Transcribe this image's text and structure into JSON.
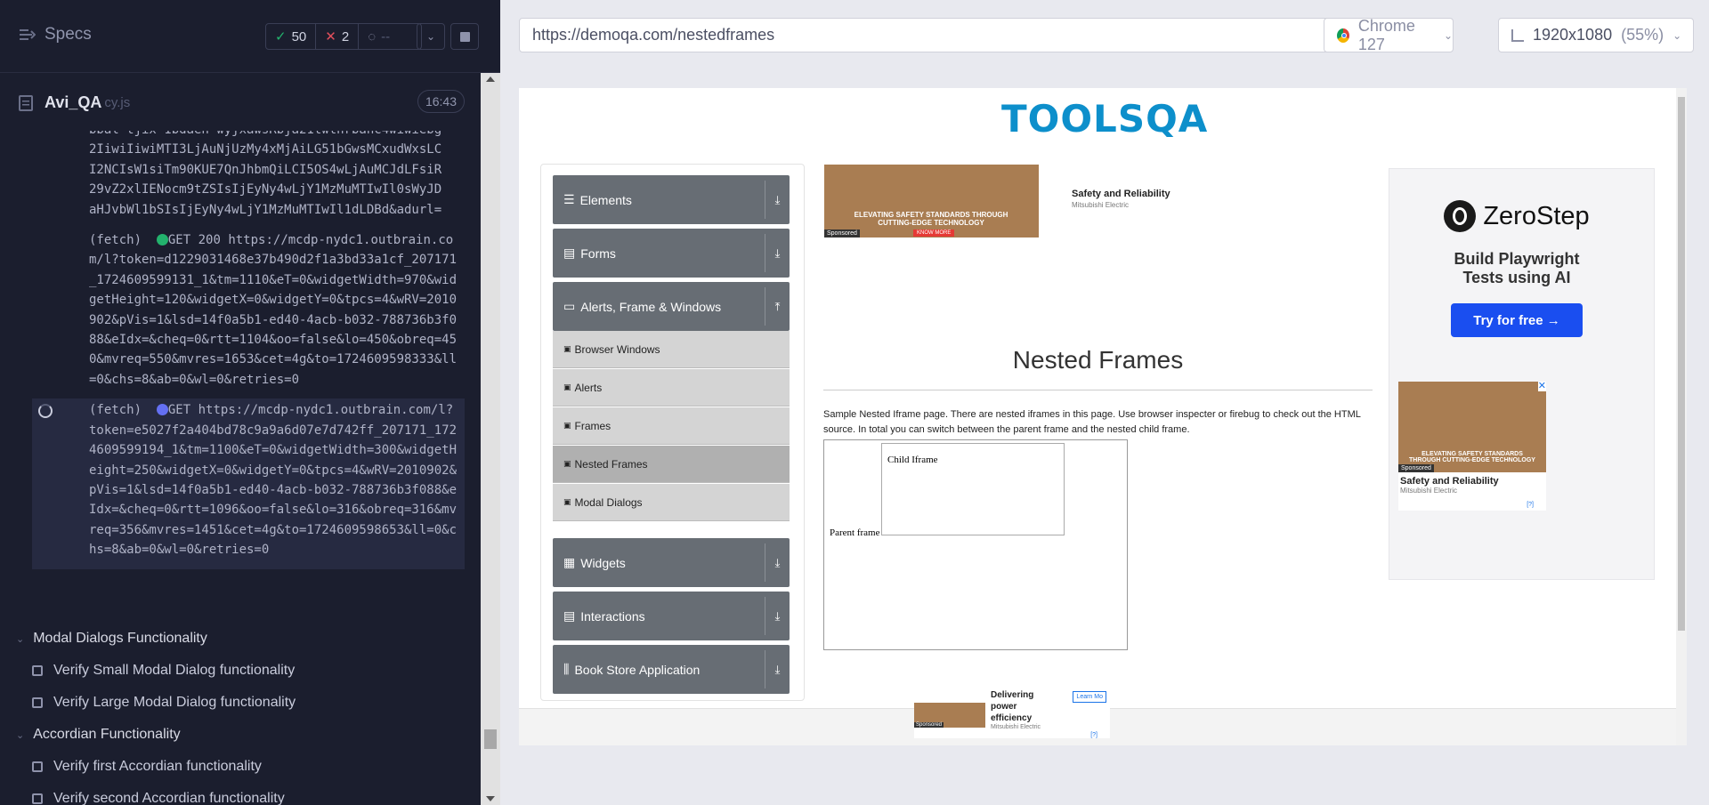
{
  "runner": {
    "specs_label": "Specs",
    "passed": "50",
    "failed": "2",
    "pending": "--",
    "file_name": "Avi_QA",
    "file_ext": "cy.js",
    "elapsed": "16:43"
  },
  "log": {
    "partial_top": "bbal tjix-1bdaeh-wyjxawsRbja21twthrbahc4wiwiebg\n2IiwiIiwiMTI3LjAuNjUzMy4xMjAiLG51bGwsMCxudWxsLC\nI2NCIsW1siTm90KUE7QnJhbmQiLCI5OS4wLjAuMCJdLFsiR\n29vZ2xlIENocm9tZSIsIjEyNy4wLjY1MzMuMTIwIl0sWyJD\naHJvbWl1bSIsIjEyNy4wLjY1MzMuMTIwIl1dLDBd&adurl=",
    "entry1": {
      "prefix": "(fetch)",
      "method_status": "GET 200",
      "url": "https://mcdp-nydc1.outbrain.com/l?token=d1229031468e37b490d2f1a3bd33a1cf_207171_1724609599131_1&tm=1110&eT=0&widgetWidth=970&widgetHeight=120&widgetX=0&widgetY=0&tpcs=4&wRV=2010902&pVis=1&lsd=14f0a5b1-ed40-4acb-b032-788736b3f088&eIdx=&cheq=0&rtt=1104&oo=false&lo=450&obreq=450&mvreq=550&mvres=1653&cet=4g&to=1724609598333&ll=0&chs=8&ab=0&wl=0&retries=0"
    },
    "entry2": {
      "prefix": "(fetch)",
      "method_status": "GET",
      "url": "https://mcdp-nydc1.outbrain.com/l?token=e5027f2a404bd78c9a9a6d07e7d742ff_207171_1724609599194_1&tm=1100&eT=0&widgetWidth=300&widgetHeight=250&widgetX=0&widgetY=0&tpcs=4&wRV=2010902&pVis=1&lsd=14f0a5b1-ed40-4acb-b032-788736b3f088&eIdx=&cheq=0&rtt=1096&oo=false&lo=316&obreq=316&mvreq=356&mvres=1451&cet=4g&to=1724609598653&ll=0&chs=8&ab=0&wl=0&retries=0"
    }
  },
  "tests": {
    "suite1": "Modal Dialogs Functionality",
    "suite1_tests": [
      "Verify Small Modal Dialog functionality",
      "Verify Large Modal Dialog functionality"
    ],
    "suite2": "Accordian Functionality",
    "suite2_tests": [
      "Verify first Accordian functionality",
      "Verify second Accordian functionality"
    ]
  },
  "browser": {
    "url": "https://demoqa.com/nestedframes",
    "browser_name": "Chrome 127",
    "viewport": "1920x1080",
    "scale": "(55%)"
  },
  "aut": {
    "logo": "TOOLSQA",
    "menu": {
      "elements": "Elements",
      "forms": "Forms",
      "alerts": "Alerts, Frame & Windows",
      "browser_windows": "Browser Windows",
      "alerts_sub": "Alerts",
      "frames": "Frames",
      "nested_frames": "Nested Frames",
      "modal_dialogs": "Modal Dialogs",
      "widgets": "Widgets",
      "interactions": "Interactions",
      "book_store": "Book Store Application"
    },
    "ad_top": {
      "caption": "ELEVATING SAFETY STANDARDS THROUGH CUTTING-EDGE TECHNOLOGY",
      "button": "KNOW MORE",
      "sponsored": "Sponsored",
      "title": "Safety and Reliability",
      "brand": "Mitsubishi Electric"
    },
    "page_title": "Nested Frames",
    "description": "Sample Nested Iframe page. There are nested iframes in this page. Use browser inspecter or firebug to check out the HTML source. In total you can switch between the parent frame and the nested child frame.",
    "child_iframe": "Child Iframe",
    "parent_frame": "Parent frame",
    "side_ad": {
      "brand": "ZeroStep",
      "headline": "Build Playwright Tests using AI",
      "cta": "Try for free →",
      "caption": "ELEVATING SAFETY STANDARDS THROUGH CUTTING-EDGE TECHNOLOGY",
      "sponsored": "Sponsored",
      "title": "Safety and Reliability",
      "company": "Mitsubishi Electric",
      "adchoice": "[?]"
    },
    "bottom_ad": {
      "sponsored": "Sponsored",
      "title": "Delivering power efficiency",
      "company": "Mitsubishi Electric",
      "learn_more": "Learn Mo",
      "adchoice": "[?]"
    }
  },
  "colors": {
    "runner_bg": "#1b1e2e",
    "pass": "#23b26d",
    "fail": "#e24f5c",
    "accent_indigo": "#6470f3",
    "menu_gray": "#676d74",
    "toolsqa_blue": "#0d8fcb",
    "zerostep_blue": "#1a4ef0"
  }
}
